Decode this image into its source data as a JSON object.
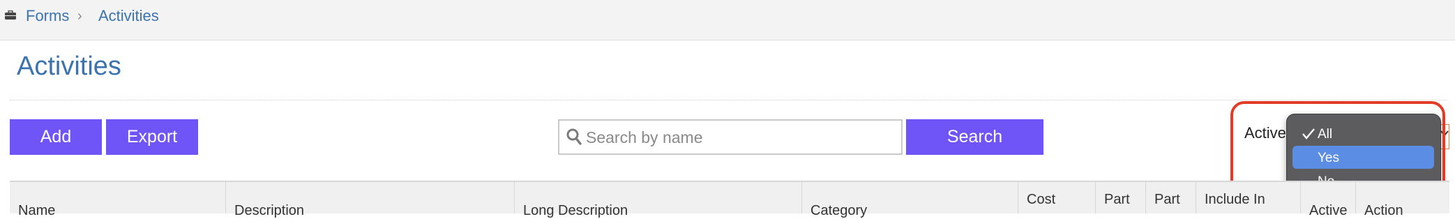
{
  "breadcrumb": {
    "items": [
      "Forms",
      "Activities"
    ],
    "separator": "›"
  },
  "page": {
    "title": "Activities"
  },
  "toolbar": {
    "add_label": "Add",
    "export_label": "Export",
    "search_placeholder": "Search by name",
    "search_label": "Search"
  },
  "filter": {
    "label": "Active",
    "options": [
      {
        "label": "All",
        "checked": true
      },
      {
        "label": "Yes",
        "highlighted": true
      },
      {
        "label": "No"
      }
    ]
  },
  "table": {
    "columns": [
      "Name",
      "Description",
      "Long Description",
      "Category",
      "Cost",
      "Part",
      "Part",
      "Include In",
      "Active",
      "Action"
    ]
  },
  "colors": {
    "accent_button": "#6f54f7",
    "link_blue": "#3b73b0",
    "dropdown_bg": "#5c5c5f",
    "dropdown_highlight": "#5b8de4",
    "annotation_red": "#e23c27"
  },
  "icons": {
    "breadcrumb": "briefcase-icon",
    "separator": "chevron-right-icon",
    "search": "search-icon",
    "check": "checkmark-icon",
    "select": "chevron-down-icon"
  }
}
